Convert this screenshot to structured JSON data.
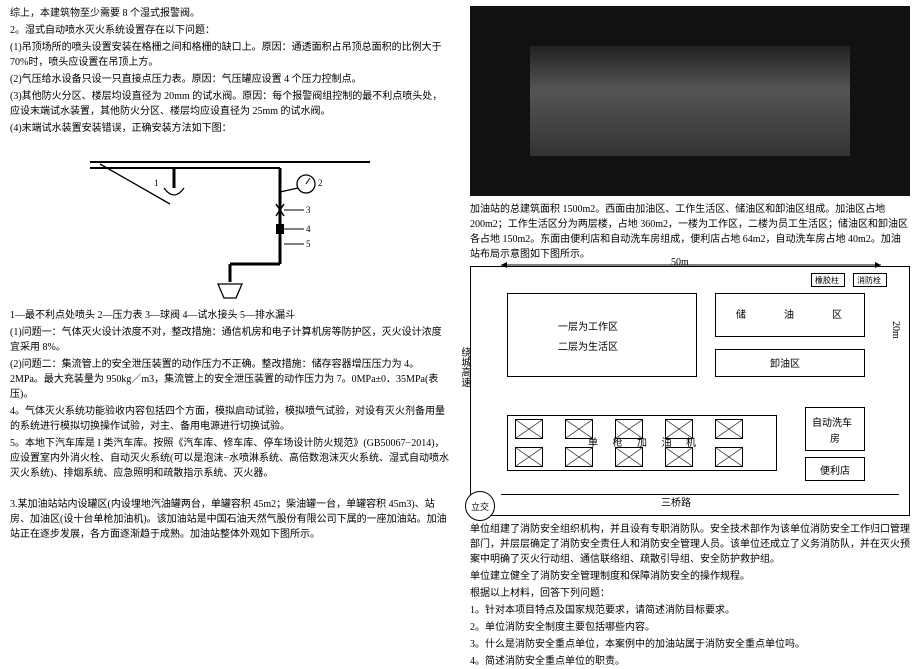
{
  "left": {
    "p1": "综上，本建筑物至少需要 8 个湿式报警阀。",
    "p2": "2。湿式自动喷水灭火系统设置存在以下问题：",
    "p3": "(1)吊顶场所的喷头设置安装在格栅之间和格栅的缺口上。原因：通透面积占吊顶总面积的比例大于 70%时，喷头应设置在吊顶上方。",
    "p4": "(2)气压给水设备只设一只直接点压力表。原因：气压罐应设置 4 个压力控制点。",
    "p5": "(3)其他防火分区、楼层均设直径为 20mm 的试水阀。原因：每个报警阀组控制的最不利点喷头处，应设末端试水装置，其他防火分区、楼层均应设直径为 25mm 的试水阀。",
    "p6": "(4)末端试水装置安装错误，正确安装方法如下图：",
    "caption": "1—最不利点处喷头 2—压力表 3—球阀 4—试水接头 5—排水漏斗",
    "p7": "(1)问题一：气体灭火设计浓度不对，整改措施：通信机房和电子计算机房等防护区，灭火设计浓度宜采用 8%。",
    "p8": "(2)问题二：集流管上的安全泄压装置的动作压力不正确。整改措施：储存容器增压压力为 4。2MPa。最大充装量为 950kg／m3，集流管上的安全泄压装置的动作压力为 7。0MPa±0．35MPa(表压)。",
    "p9": "4。气体灭火系统功能验收内容包括四个方面，模拟启动试验，模拟喷气试验，对设有灭火剂备用量的系统进行模拟切换操作试验，对主、备用电源进行切换试验。",
    "p10": "5。本地下汽车库是 I 类汽车库。按照《汽车库、修车库、停车场设计防火规范》(GB50067−2014)，应设置室内外消火栓、自动灭火系统(可以是泡沫−水喷淋系统、高倍数泡沫灭火系统、湿式自动喷水灭火系统)、排烟系统、应急照明和疏散指示系统、灭火器。",
    "q3intro": "3.某加油站站内设罐区(内设埋地汽油罐两台，单罐容积 45m2；柴油罐一台，单罐容积 45m3)、站房、加油区(设十台单枪加油机)。该加油站是中国石油天然气股份有限公司下属的一座加油站。加油站正在逐步发展，各方面逐渐趋于成熟。加油站整体外观如下图所示。"
  },
  "right": {
    "p1": "加油站的总建筑面积 1500m2。西面由加油区、工作生活区、储油区和卸油区组成。加油区占地 200m2；工作生活区分为两层楼，占地 360m2，一楼为工作区，二楼为员工生活区；储油区和卸油区各占地 150m2。东面由便利店和自动洗车房组成，便利店占地 64m2，自动洗车房占地 40m2。加油站布局示意图如下图所示。",
    "map": {
      "top": "50m",
      "leftRoad": "绕城高速",
      "rightRoad": "20m",
      "bottomRoad": "三桥路",
      "lijiao": "立交",
      "workArea1": "一层为工作区",
      "workArea2": "二层为生活区",
      "chu": "储",
      "you": "油",
      "qu": "区",
      "xieyou": "卸油区",
      "jiayou": "单 枪 加 油 机",
      "xiche1": "自动洗车",
      "xiche2": "房",
      "bianli": "便利店",
      "xiaofang": "消防栓",
      "xiangjiao": "橡胶柱"
    },
    "p2": "单位组建了消防安全组织机构，并且设有专职消防队。安全技术部作为该单位消防安全工作归口管理部门，并层层确定了消防安全责任人和消防安全管理人员。该单位还成立了义务消防队，并在灭火预案中明确了灭火行动组、通信联络组、疏散引导组、安全防护救护组。",
    "p3": "单位建立健全了消防安全管理制度和保障消防安全的操作规程。",
    "p4": "根据以上材料，回答下列问题：",
    "q1": "1。针对本项目特点及国家规范要求，请简述消防目标要求。",
    "q2": "2。单位消防安全制度主要包括哪些内容。",
    "q3": "3。什么是消防安全重点单位，本案例中的加油站属于消防安全重点单位吗。",
    "q4": "4。简述消防安全重点单位的职责。"
  }
}
